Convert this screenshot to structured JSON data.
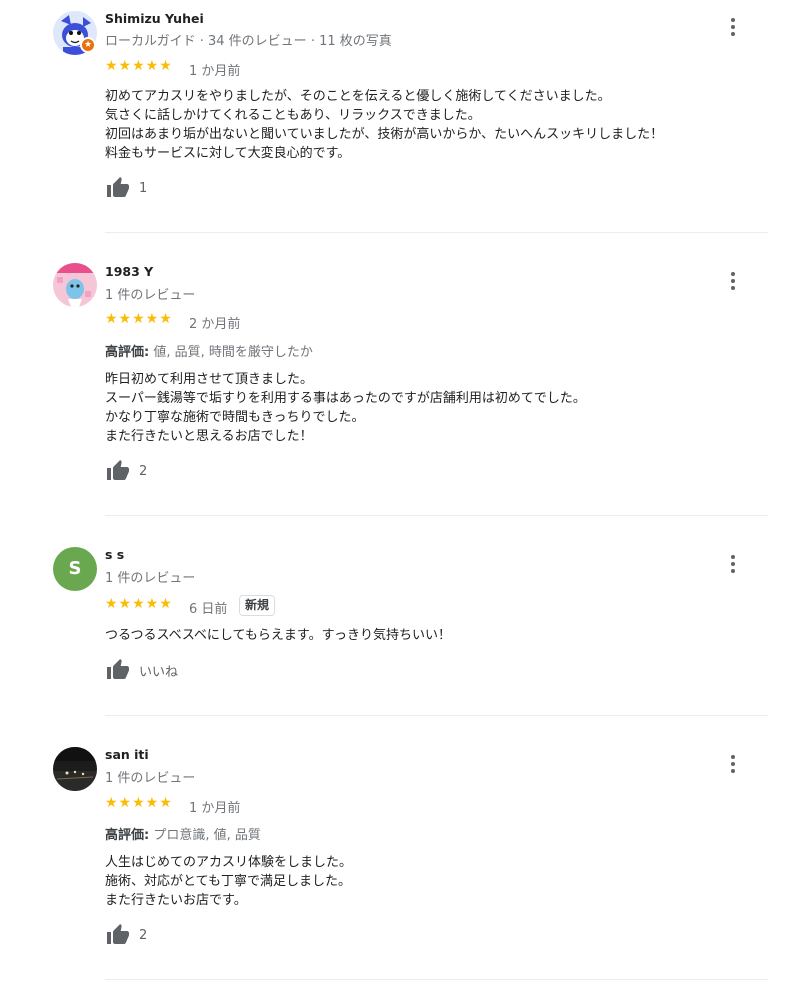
{
  "reviews": [
    {
      "name": "Shimizu Yuhei",
      "meta": "ローカルガイド · 34 件のレビュー · 11 枚の写真",
      "stars": "★★★★★",
      "date": "1 か月前",
      "lines": [
        "初めてアカスリをやりましたが、そのことを伝えると優しく施術してくださいました。",
        "気さくに話しかけてくれることもあり、リラックスできました。",
        "初回はあまり垢が出ないと聞いていましたが、技術が高いからか、たいへんスッキリしました！",
        "料金もサービスに対して大変良心的です。"
      ],
      "likes": "1"
    },
    {
      "name": "1983 Y",
      "meta": "1 件のレビュー",
      "stars": "★★★★★",
      "date": "2 か月前",
      "highlight_label": "高評価:",
      "highlight_value": " 値, 品質, 時間を厳守したか",
      "lines": [
        "昨日初めて利用させて頂きました。",
        "スーパー銭湯等で垢すりを利用する事はあったのですが店舗利用は初めてでした。",
        "かなり丁寧な施術で時間もきっちりでした。",
        "また行きたいと思えるお店でした！"
      ],
      "likes": "2"
    },
    {
      "name": "s s",
      "avatar_letter": "S",
      "meta": "1 件のレビュー",
      "stars": "★★★★★",
      "date": "6 日前",
      "badge": "新規",
      "lines": [
        "つるつるスベスベにしてもらえます。すっきり気持ちいい！"
      ],
      "likes": "いいね"
    },
    {
      "name": "san iti",
      "meta": "1 件のレビュー",
      "stars": "★★★★★",
      "date": "1 か月前",
      "highlight_label": "高評価:",
      "highlight_value": " プロ意識, 値, 品質",
      "lines": [
        "人生はじめてのアカスリ体験をしました。",
        "施術、対応がとても丁寧で満足しました。",
        "また行きたいお店です。"
      ],
      "likes": "2"
    }
  ],
  "colors": {
    "star": "#fbbc04",
    "avatar_s": "#6aa84f",
    "local_guide_badge": "#e8710a"
  },
  "icons": {
    "like": "thumb-up-icon",
    "more": "more-vert-icon",
    "local_guide": "local-guide-star-icon"
  }
}
